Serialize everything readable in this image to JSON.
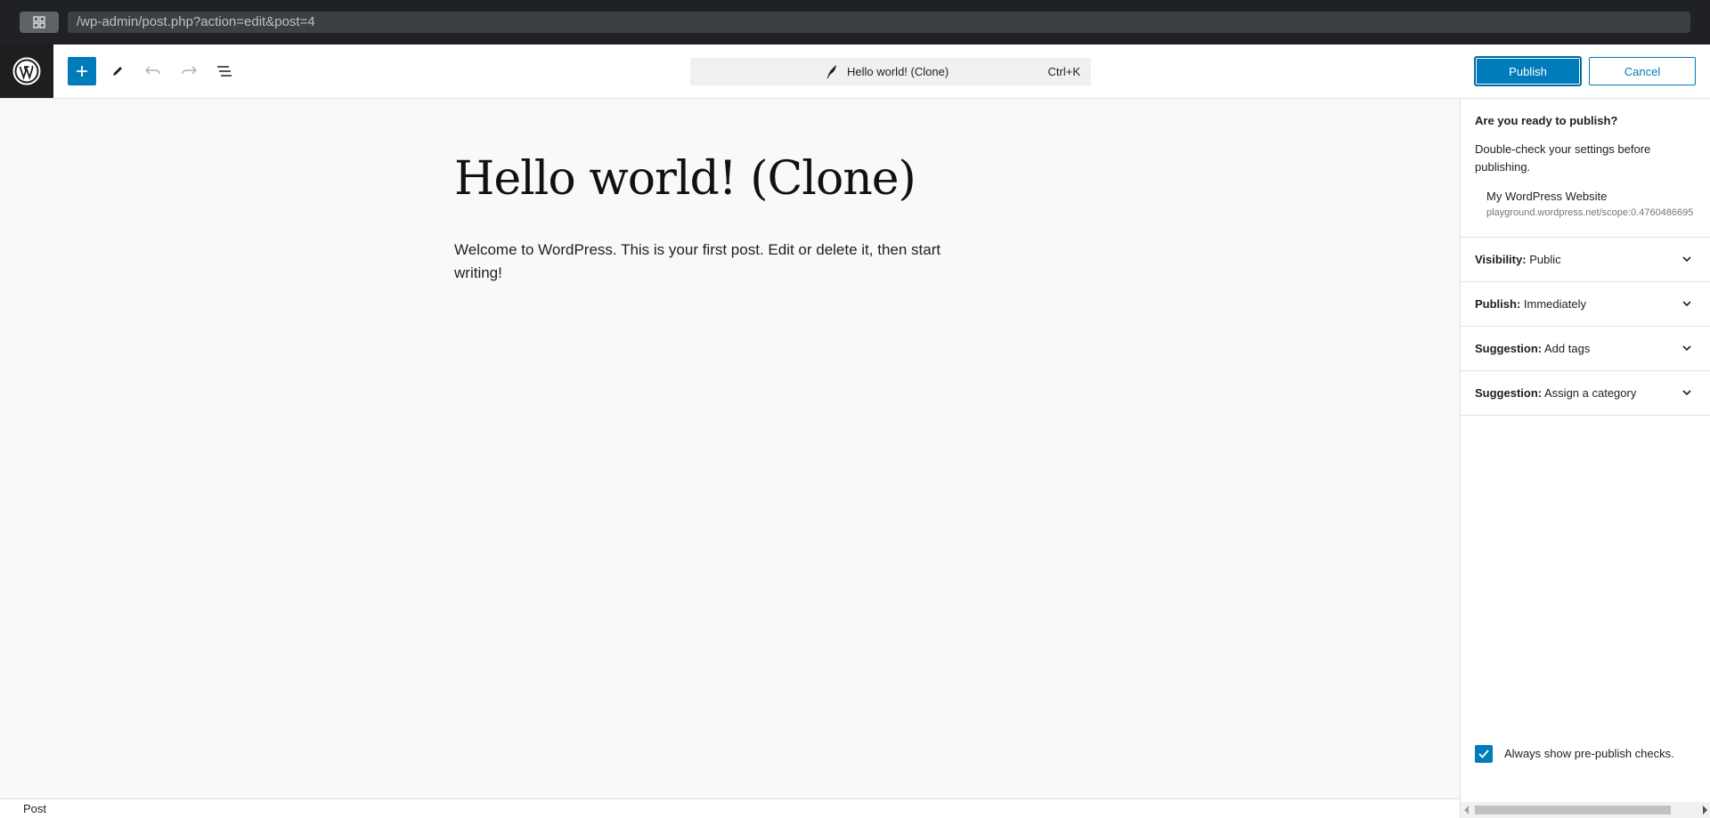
{
  "browser": {
    "url": "/wp-admin/post.php?action=edit&post=4"
  },
  "toolbar": {
    "document_title": "Hello world! (Clone)",
    "shortcut": "Ctrl+K",
    "publish_label": "Publish",
    "cancel_label": "Cancel"
  },
  "post": {
    "title": "Hello world! (Clone)",
    "body": "Welcome to WordPress. This is your first post. Edit or delete it, then start writing!"
  },
  "footer": {
    "breadcrumb": "Post"
  },
  "sidebar": {
    "ready_title": "Are you ready to publish?",
    "ready_desc": "Double-check your settings before publishing.",
    "site_name": "My WordPress Website",
    "site_url": "playground.wordpress.net/scope:0.4760486695",
    "panels": [
      {
        "label": "Visibility:",
        "value": "Public"
      },
      {
        "label": "Publish:",
        "value": "Immediately"
      },
      {
        "label": "Suggestion:",
        "value": "Add tags"
      },
      {
        "label": "Suggestion:",
        "value": "Assign a category"
      }
    ],
    "always_show_label": "Always show pre-publish checks.",
    "always_show_checked": true
  },
  "colors": {
    "accent": "#007cba",
    "browser_bg": "#202124"
  }
}
